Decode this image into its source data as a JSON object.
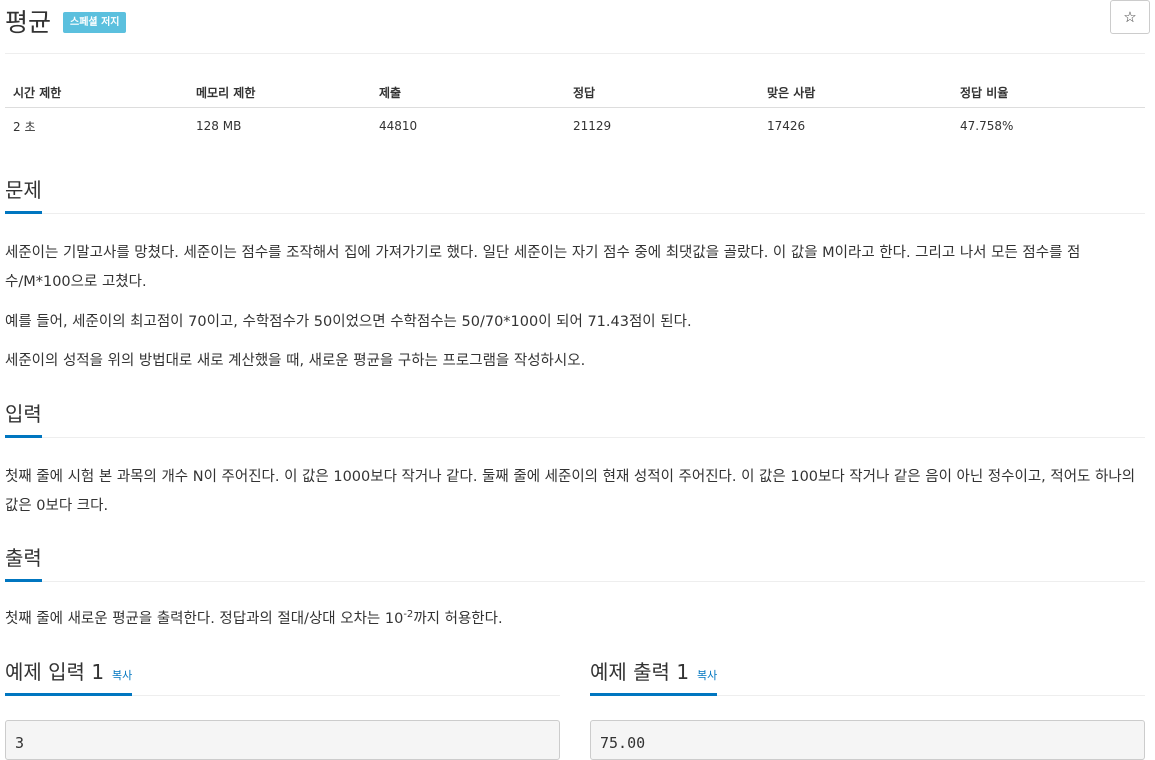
{
  "problem": {
    "title": "평균",
    "badge": "스페셜 저지",
    "star_icon": "☆"
  },
  "info_table": {
    "headers": [
      "시간 제한",
      "메모리 제한",
      "제출",
      "정답",
      "맞은 사람",
      "정답 비율"
    ],
    "values": [
      "2 초",
      "128 MB",
      "44810",
      "21129",
      "17426",
      "47.758%"
    ]
  },
  "sections": {
    "problem": {
      "title": "문제",
      "paragraphs": [
        "세준이는 기말고사를 망쳤다. 세준이는 점수를 조작해서 집에 가져가기로 했다. 일단 세준이는 자기 점수 중에 최댓값을 골랐다. 이 값을 M이라고 한다. 그리고 나서 모든 점수를 점수/M*100으로 고쳤다.",
        "예를 들어, 세준이의 최고점이 70이고, 수학점수가 50이었으면 수학점수는 50/70*100이 되어 71.43점이 된다.",
        "세준이의 성적을 위의 방법대로 새로 계산했을 때, 새로운 평균을 구하는 프로그램을 작성하시오."
      ]
    },
    "input": {
      "title": "입력",
      "text": "첫째 줄에 시험 본 과목의 개수 N이 주어진다. 이 값은 1000보다 작거나 같다. 둘째 줄에 세준이의 현재 성적이 주어진다. 이 값은 100보다 작거나 같은 음이 아닌 정수이고, 적어도 하나의 값은 0보다 크다."
    },
    "output": {
      "title": "출력",
      "text_before": "첫째 줄에 새로운 평균을 출력한다. 정답과의 절대/상대 오차는 10",
      "superscript": "-2",
      "text_after": "까지 허용한다."
    }
  },
  "samples": {
    "input": {
      "title": "예제 입력 1",
      "copy_label": "복사",
      "value": "3"
    },
    "output": {
      "title": "예제 출력 1",
      "copy_label": "복사",
      "value": "75.00"
    }
  },
  "colors": {
    "accent": "#0076c0",
    "badge": "#5bc0de"
  }
}
